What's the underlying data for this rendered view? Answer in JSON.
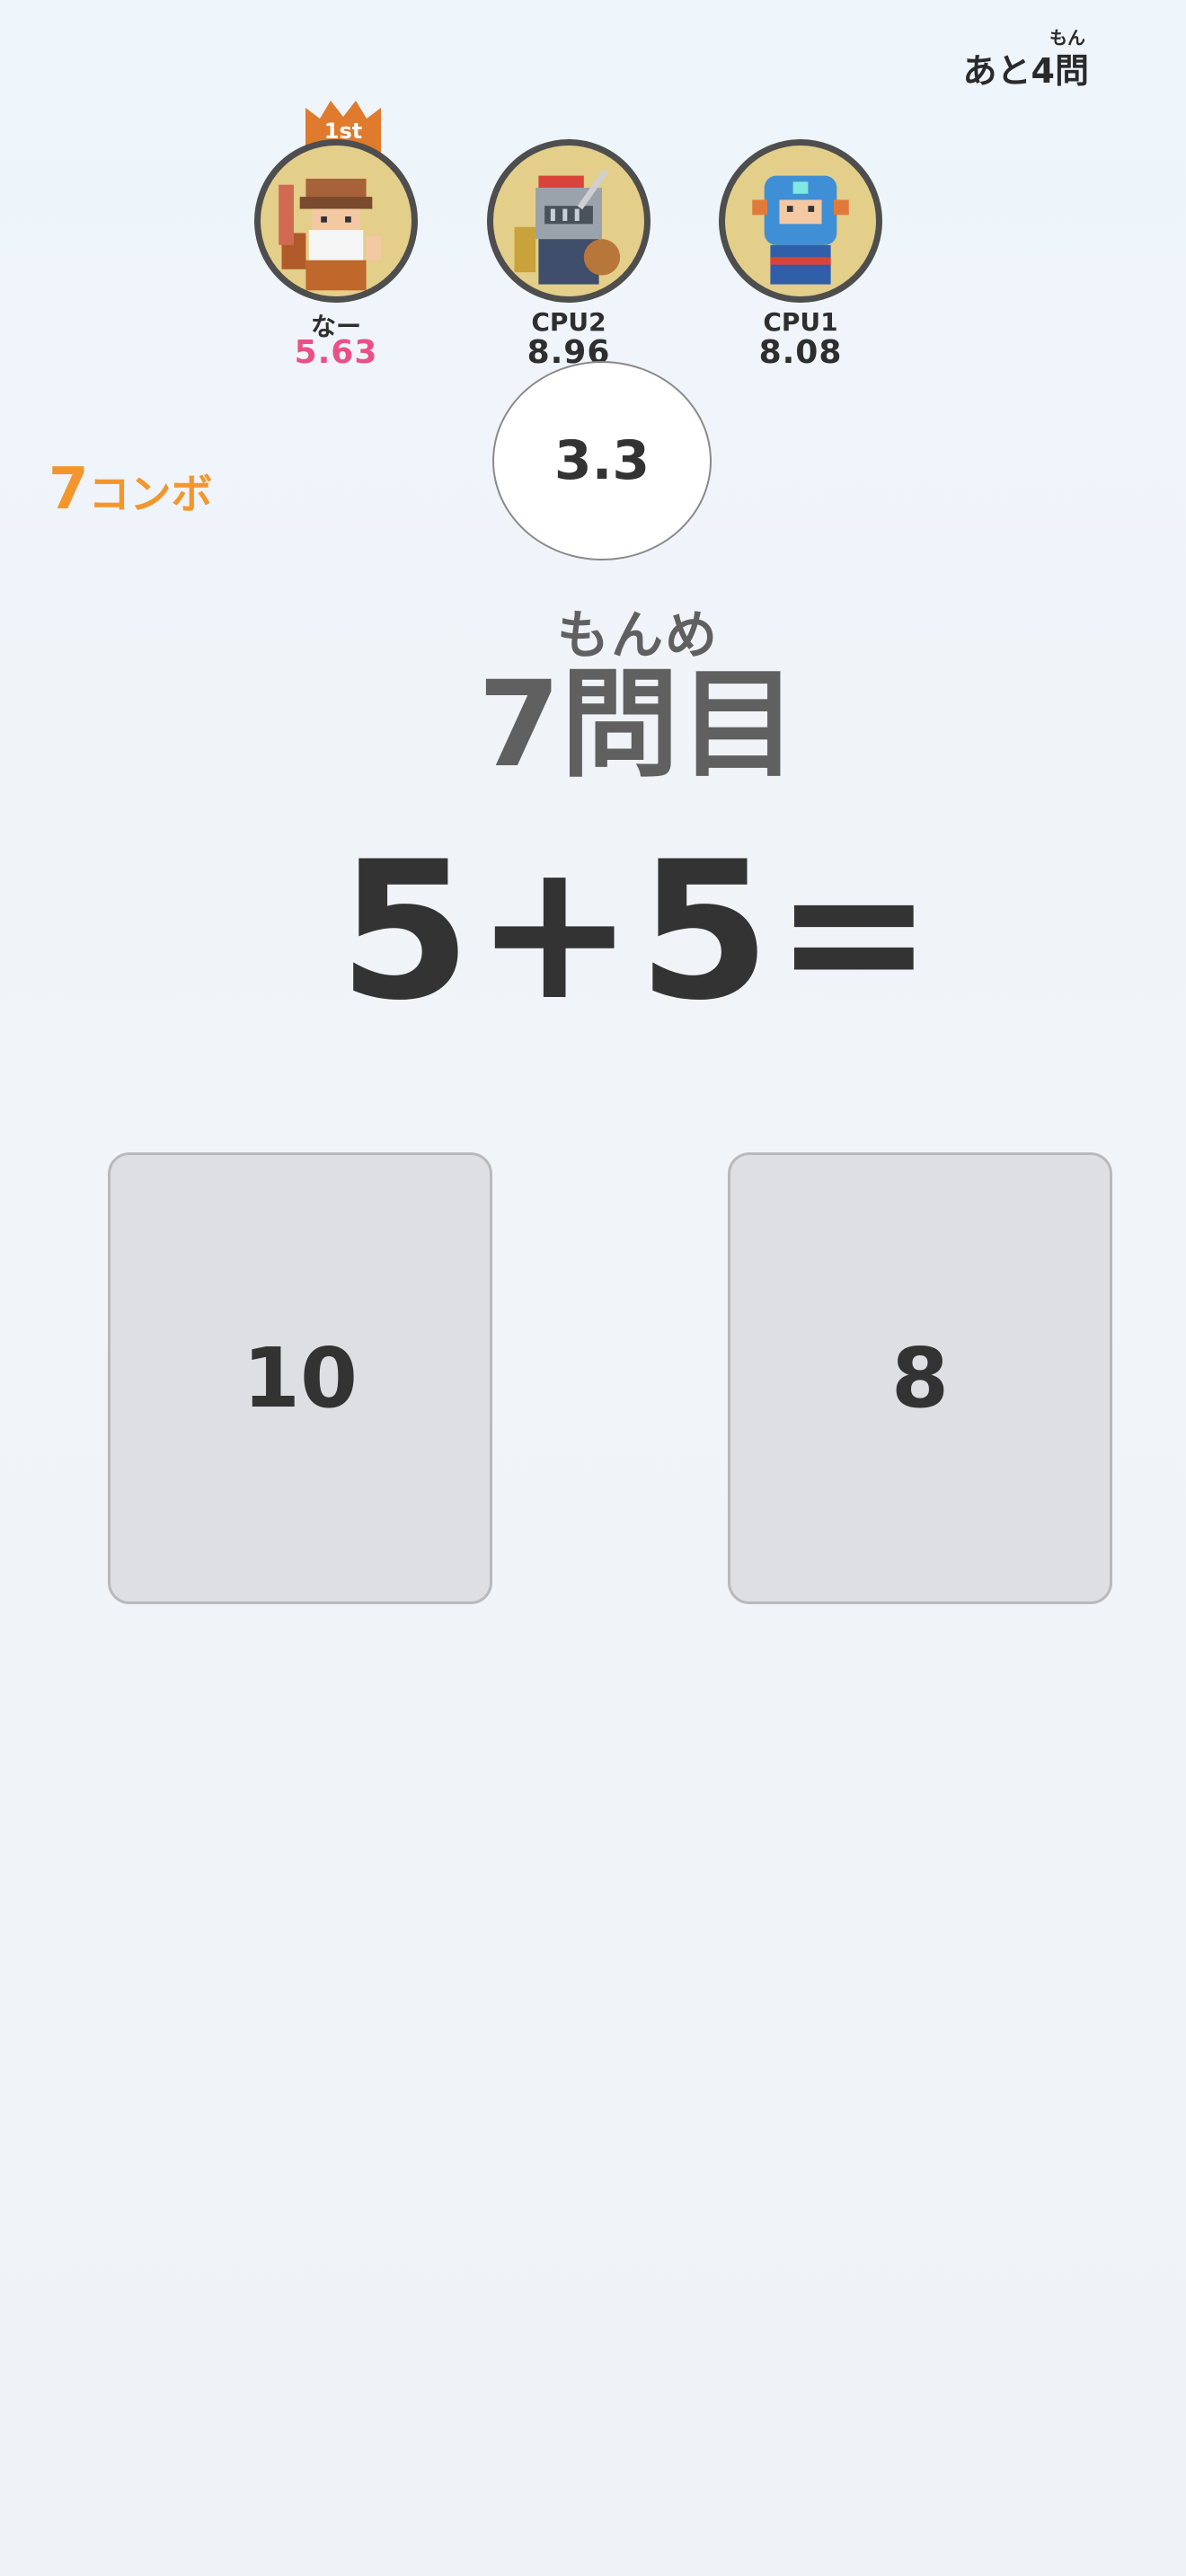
{
  "header": {
    "remaining_ruby": "もん",
    "remaining_text": "あと4問"
  },
  "players": [
    {
      "name": "なー",
      "time": "5.63",
      "rank_badge": "1st",
      "avatar": "bearded-warrior-avatar"
    },
    {
      "name": "CPU2",
      "time": "8.96",
      "avatar": "knight-avatar"
    },
    {
      "name": "CPU1",
      "time": "8.08",
      "avatar": "blue-hooded-avatar"
    }
  ],
  "timer": {
    "value": "3.3"
  },
  "combo": {
    "count": "7",
    "label": "コンボ"
  },
  "question": {
    "ruby": "もんめ",
    "number": "7問目",
    "expression": "5+5="
  },
  "answers": [
    "10",
    "8"
  ],
  "colors": {
    "combo": "#f3962c",
    "leader_time": "#ec4f86",
    "rank_badge": "#e07a2c",
    "avatar_bg": "#e3ce8a"
  }
}
